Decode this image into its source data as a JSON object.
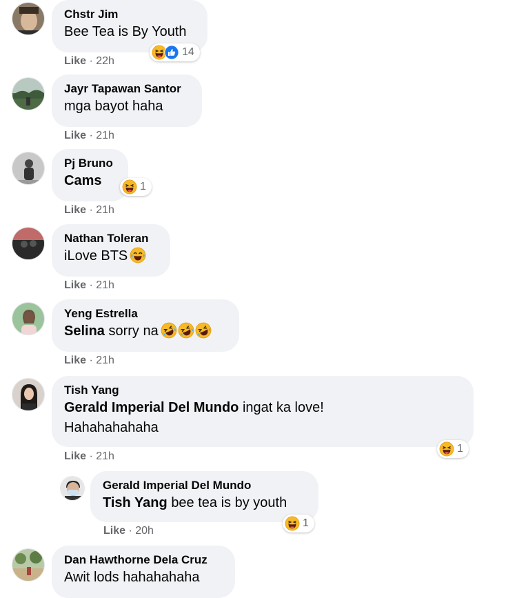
{
  "comments": [
    {
      "author": "Chstr Jim",
      "text": "Bee Tea is By Youth",
      "like": "Like",
      "time": "22h",
      "reactions": "14"
    },
    {
      "author": "Jayr Tapawan Santor",
      "text": "mga bayot haha",
      "like": "Like",
      "time": "21h"
    },
    {
      "author": "Pj Bruno",
      "mention": "Cams",
      "like": "Like",
      "time": "21h",
      "reactions": "1"
    },
    {
      "author": "Nathan Toleran",
      "text": "iLove BTS",
      "like": "Like",
      "time": "21h"
    },
    {
      "author": "Yeng Estrella",
      "mention": "Selina",
      "text": "sorry na",
      "like": "Like",
      "time": "21h"
    },
    {
      "author": "Tish Yang",
      "mention": "Gerald Imperial Del Mundo",
      "text": "ingat ka love!",
      "text2": "Hahahahahaha",
      "like": "Like",
      "time": "21h",
      "reactions": "1"
    },
    {
      "author": "Gerald Imperial Del Mundo",
      "mention": "Tish Yang",
      "text": "bee tea is by youth",
      "like": "Like",
      "time": "20h",
      "reactions": "1"
    },
    {
      "author": "Dan Hawthorne Dela Cruz",
      "text": "Awit lods hahahahaha"
    }
  ],
  "icons": {
    "haha": "haha-reaction-icon",
    "like": "like-reaction-icon",
    "rofl": "rolling-laughing-emoji",
    "joy": "tears-of-joy-emoji"
  },
  "colors": {
    "bubble": "#f0f2f5",
    "meta": "#65676b",
    "like_blue": "#1877f2",
    "haha": "#f7b928"
  }
}
